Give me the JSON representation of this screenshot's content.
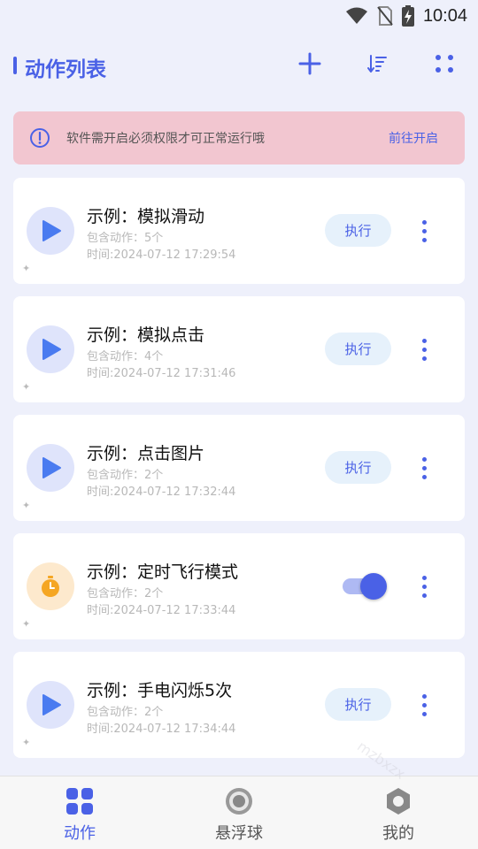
{
  "status_bar": {
    "time": "10:04",
    "icons": [
      "wifi-icon",
      "no-sim-icon",
      "battery-charging-icon"
    ]
  },
  "header": {
    "title": "动作列表",
    "buttons": [
      "add-icon",
      "sort-icon",
      "grid-icon"
    ]
  },
  "banner": {
    "message": "软件需开启必须权限才可正常运行哦",
    "action_label": "前往开启",
    "icon": "warning-circle-icon"
  },
  "actions": [
    {
      "name": "示例：模拟滑动",
      "count": "包含动作：5个",
      "time": "时间:2024-07-12 17:29:54",
      "type": "play",
      "run_label": "执行",
      "pin": "✦"
    },
    {
      "name": "示例：模拟点击",
      "count": "包含动作：4个",
      "time": "时间:2024-07-12 17:31:46",
      "type": "play",
      "run_label": "执行",
      "pin": "✦"
    },
    {
      "name": "示例：点击图片",
      "count": "包含动作：2个",
      "time": "时间:2024-07-12 17:32:44",
      "type": "play",
      "run_label": "执行",
      "pin": "✦"
    },
    {
      "name": "示例：定时飞行模式",
      "count": "包含动作：2个",
      "time": "时间:2024-07-12 17:33:44",
      "type": "timer",
      "toggle_on": true,
      "pin": "✦"
    },
    {
      "name": "示例：手电闪烁5次",
      "count": "包含动作：2个",
      "time": "时间:2024-07-12 17:34:44",
      "type": "play",
      "run_label": "执行",
      "pin": "✦"
    }
  ],
  "bottom_nav": [
    {
      "label": "动作",
      "icon": "four-squares-icon",
      "active": true
    },
    {
      "label": "悬浮球",
      "icon": "floating-ball-icon",
      "active": false
    },
    {
      "label": "我的",
      "icon": "hexagon-profile-icon",
      "active": false
    }
  ],
  "watermark": "mzbxzx",
  "colors": {
    "accent": "#4a61e6",
    "background": "#eef0fb",
    "banner_bg": "#f2c6d0",
    "run_button_bg": "#e6f1fb",
    "play_circle_bg": "#dfe4fb",
    "timer_circle_bg": "#fde9cd",
    "timer_icon": "#f5a623"
  }
}
